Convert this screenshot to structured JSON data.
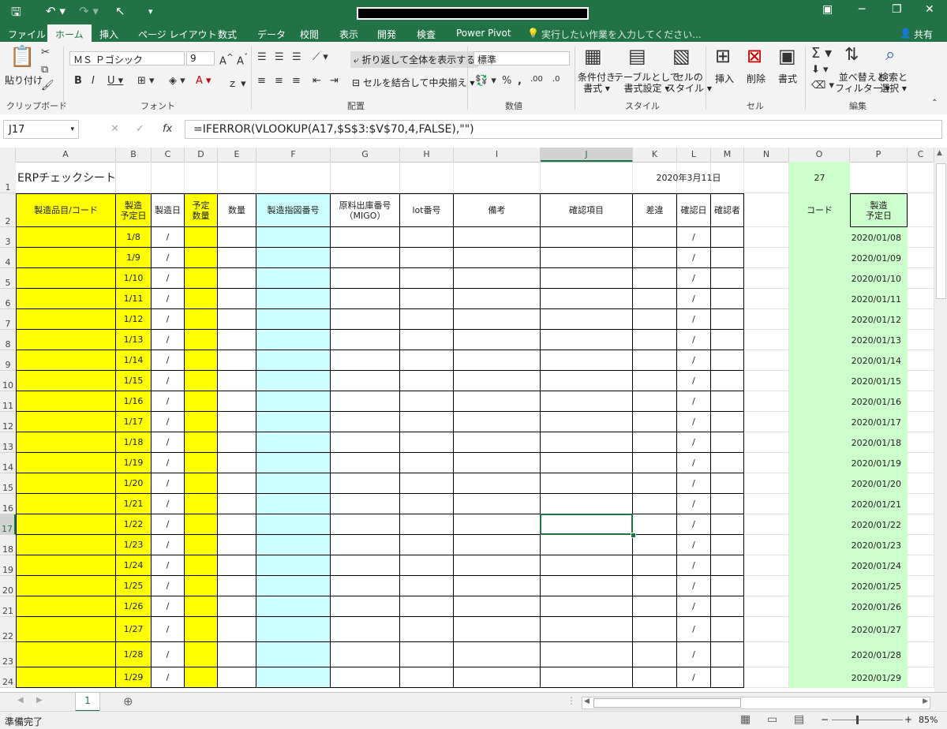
{
  "titlebar": {
    "save_icon": "save-icon",
    "undo_icon": "undo-icon",
    "redo_icon": "redo-icon",
    "cursor_icon": "pointer-icon"
  },
  "tabs": [
    "ファイル",
    "ホーム",
    "挿入",
    "ページ レイアウト",
    "数式",
    "データ",
    "校閲",
    "表示",
    "開発",
    "検査",
    "Power Pivot"
  ],
  "tell_me": "実行したい作業を入力してください...",
  "share": "共有",
  "ribbon": {
    "paste": "貼り付け",
    "font_name": "ＭＳ Ｐゴシック",
    "font_size": "9",
    "wrap_text": "折り返して全体を表示する",
    "merge_center": "セルを結合して中央揃え",
    "number_format": "標準",
    "cond_format": [
      "条件付き",
      "書式 ▾"
    ],
    "table_format": [
      "テーブルとして",
      "書式設定 ▾"
    ],
    "cell_style": [
      "セルの",
      "スタイル ▾"
    ],
    "insert": "挿入",
    "delete": "削除",
    "format": "書式",
    "sort_filter": [
      "並べ替えと",
      "フィルター ▾"
    ],
    "find_select": [
      "検索と",
      "選択 ▾"
    ],
    "groups": [
      "クリップボード",
      "フォント",
      "配置",
      "数値",
      "スタイル",
      "セル",
      "編集"
    ]
  },
  "formula_bar": {
    "name_box": "J17",
    "formula": "=IFERROR(VLOOKUP(A17,$S$3:$V$70,4,FALSE),\"\")"
  },
  "columns": [
    "A",
    "B",
    "C",
    "D",
    "E",
    "F",
    "G",
    "H",
    "I",
    "J",
    "K",
    "L",
    "M",
    "N",
    "O",
    "P",
    "C"
  ],
  "sheet": {
    "title": "ERPチェックシート",
    "date": "2020年3月11日",
    "o1": "27",
    "headers": {
      "a": "製造品目/コード",
      "b": "製造\n予定日",
      "c": "製造日",
      "d": "予定\n数量",
      "e": "数量",
      "f": "製造指図番号",
      "g": "原料出庫番号\n（MIGO）",
      "h": "lot番号",
      "i": "備考",
      "j": "確認項目",
      "k": "差違",
      "l": "確認日",
      "m": "確認者",
      "o": "コード",
      "p": "製造\n予定日"
    },
    "rows": [
      {
        "num": "3",
        "b": "1/8",
        "p": "2020/01/08"
      },
      {
        "num": "4",
        "b": "1/9",
        "p": "2020/01/09"
      },
      {
        "num": "5",
        "b": "1/10",
        "p": "2020/01/10"
      },
      {
        "num": "6",
        "b": "1/11",
        "p": "2020/01/11"
      },
      {
        "num": "7",
        "b": "1/12",
        "p": "2020/01/12"
      },
      {
        "num": "8",
        "b": "1/13",
        "p": "2020/01/13"
      },
      {
        "num": "9",
        "b": "1/14",
        "p": "2020/01/14"
      },
      {
        "num": "10",
        "b": "1/15",
        "p": "2020/01/15"
      },
      {
        "num": "11",
        "b": "1/16",
        "p": "2020/01/16"
      },
      {
        "num": "12",
        "b": "1/17",
        "p": "2020/01/17"
      },
      {
        "num": "13",
        "b": "1/18",
        "p": "2020/01/18"
      },
      {
        "num": "14",
        "b": "1/19",
        "p": "2020/01/19"
      },
      {
        "num": "15",
        "b": "1/20",
        "p": "2020/01/20"
      },
      {
        "num": "16",
        "b": "1/21",
        "p": "2020/01/21"
      },
      {
        "num": "17",
        "b": "1/22",
        "p": "2020/01/22"
      },
      {
        "num": "18",
        "b": "1/23",
        "p": "2020/01/23"
      },
      {
        "num": "19",
        "b": "1/24",
        "p": "2020/01/24"
      },
      {
        "num": "20",
        "b": "1/25",
        "p": "2020/01/25"
      },
      {
        "num": "21",
        "b": "1/26",
        "p": "2020/01/26"
      },
      {
        "num": "22",
        "b": "1/27",
        "p": "2020/01/27"
      },
      {
        "num": "23",
        "b": "1/28",
        "p": "2020/01/28"
      },
      {
        "num": "24",
        "b": "1/29",
        "p": "2020/01/29"
      }
    ],
    "slash": "/"
  },
  "sheet_tab": "1",
  "status": {
    "ready": "準備完了",
    "zoom": "85%"
  },
  "colors": {
    "excel_green": "#217346",
    "yellow": "#ffff00",
    "cyan": "#ccffff",
    "light_green": "#ccffcc"
  }
}
